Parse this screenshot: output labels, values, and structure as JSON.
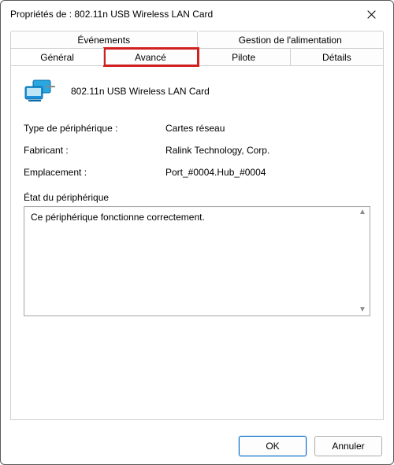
{
  "window": {
    "title": "Propriétés de : 802.11n USB Wireless LAN Card"
  },
  "tabs": {
    "row1": [
      "Événements",
      "Gestion de l'alimentation"
    ],
    "row2": [
      "Général",
      "Avancé",
      "Pilote",
      "Détails"
    ],
    "active": "Général",
    "highlighted": "Avancé"
  },
  "device": {
    "name": "802.11n USB Wireless LAN Card"
  },
  "info": {
    "type_label": "Type de périphérique :",
    "type_value": "Cartes réseau",
    "mfr_label": "Fabricant :",
    "mfr_value": "Ralink Technology, Corp.",
    "loc_label": "Emplacement :",
    "loc_value": "Port_#0004.Hub_#0004"
  },
  "status": {
    "group_label": "État du périphérique",
    "text": "Ce périphérique fonctionne correctement."
  },
  "buttons": {
    "ok": "OK",
    "cancel": "Annuler"
  }
}
